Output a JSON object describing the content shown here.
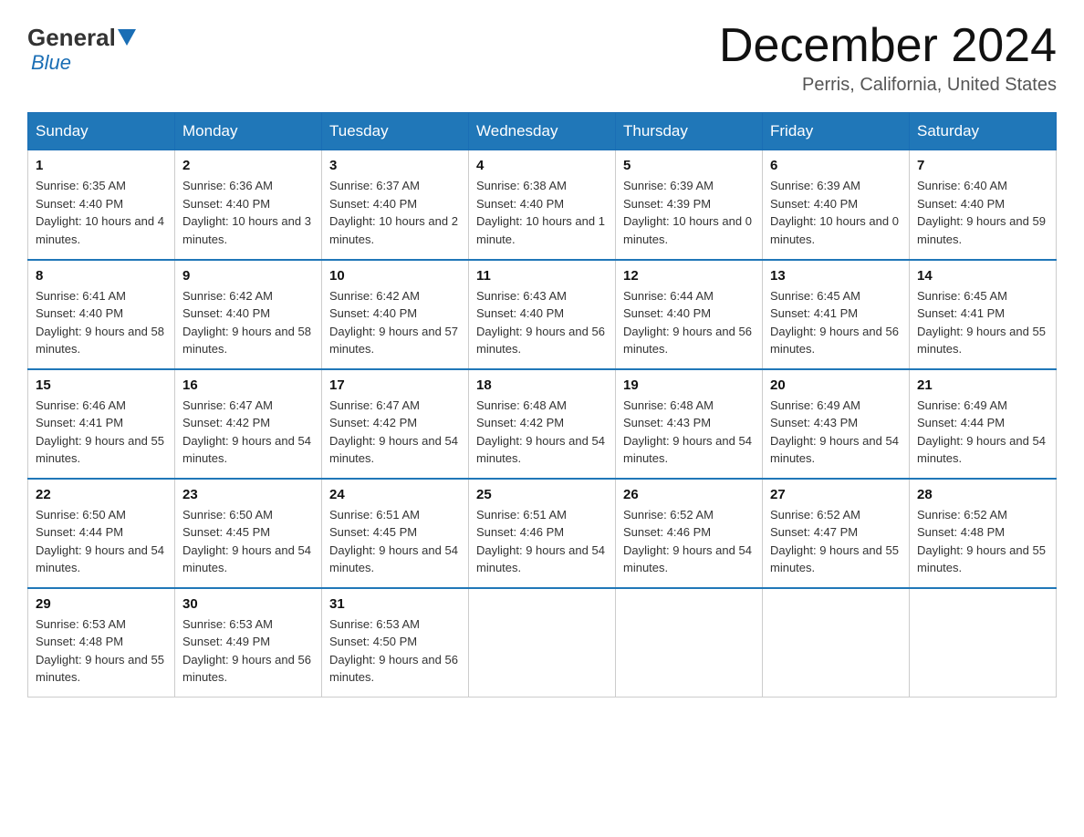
{
  "logo": {
    "general": "General",
    "blue": "Blue"
  },
  "title": "December 2024",
  "location": "Perris, California, United States",
  "weekdays": [
    "Sunday",
    "Monday",
    "Tuesday",
    "Wednesday",
    "Thursday",
    "Friday",
    "Saturday"
  ],
  "weeks": [
    [
      {
        "day": "1",
        "sunrise": "6:35 AM",
        "sunset": "4:40 PM",
        "daylight": "10 hours and 4 minutes."
      },
      {
        "day": "2",
        "sunrise": "6:36 AM",
        "sunset": "4:40 PM",
        "daylight": "10 hours and 3 minutes."
      },
      {
        "day": "3",
        "sunrise": "6:37 AM",
        "sunset": "4:40 PM",
        "daylight": "10 hours and 2 minutes."
      },
      {
        "day": "4",
        "sunrise": "6:38 AM",
        "sunset": "4:40 PM",
        "daylight": "10 hours and 1 minute."
      },
      {
        "day": "5",
        "sunrise": "6:39 AM",
        "sunset": "4:39 PM",
        "daylight": "10 hours and 0 minutes."
      },
      {
        "day": "6",
        "sunrise": "6:39 AM",
        "sunset": "4:40 PM",
        "daylight": "10 hours and 0 minutes."
      },
      {
        "day": "7",
        "sunrise": "6:40 AM",
        "sunset": "4:40 PM",
        "daylight": "9 hours and 59 minutes."
      }
    ],
    [
      {
        "day": "8",
        "sunrise": "6:41 AM",
        "sunset": "4:40 PM",
        "daylight": "9 hours and 58 minutes."
      },
      {
        "day": "9",
        "sunrise": "6:42 AM",
        "sunset": "4:40 PM",
        "daylight": "9 hours and 58 minutes."
      },
      {
        "day": "10",
        "sunrise": "6:42 AM",
        "sunset": "4:40 PM",
        "daylight": "9 hours and 57 minutes."
      },
      {
        "day": "11",
        "sunrise": "6:43 AM",
        "sunset": "4:40 PM",
        "daylight": "9 hours and 56 minutes."
      },
      {
        "day": "12",
        "sunrise": "6:44 AM",
        "sunset": "4:40 PM",
        "daylight": "9 hours and 56 minutes."
      },
      {
        "day": "13",
        "sunrise": "6:45 AM",
        "sunset": "4:41 PM",
        "daylight": "9 hours and 56 minutes."
      },
      {
        "day": "14",
        "sunrise": "6:45 AM",
        "sunset": "4:41 PM",
        "daylight": "9 hours and 55 minutes."
      }
    ],
    [
      {
        "day": "15",
        "sunrise": "6:46 AM",
        "sunset": "4:41 PM",
        "daylight": "9 hours and 55 minutes."
      },
      {
        "day": "16",
        "sunrise": "6:47 AM",
        "sunset": "4:42 PM",
        "daylight": "9 hours and 54 minutes."
      },
      {
        "day": "17",
        "sunrise": "6:47 AM",
        "sunset": "4:42 PM",
        "daylight": "9 hours and 54 minutes."
      },
      {
        "day": "18",
        "sunrise": "6:48 AM",
        "sunset": "4:42 PM",
        "daylight": "9 hours and 54 minutes."
      },
      {
        "day": "19",
        "sunrise": "6:48 AM",
        "sunset": "4:43 PM",
        "daylight": "9 hours and 54 minutes."
      },
      {
        "day": "20",
        "sunrise": "6:49 AM",
        "sunset": "4:43 PM",
        "daylight": "9 hours and 54 minutes."
      },
      {
        "day": "21",
        "sunrise": "6:49 AM",
        "sunset": "4:44 PM",
        "daylight": "9 hours and 54 minutes."
      }
    ],
    [
      {
        "day": "22",
        "sunrise": "6:50 AM",
        "sunset": "4:44 PM",
        "daylight": "9 hours and 54 minutes."
      },
      {
        "day": "23",
        "sunrise": "6:50 AM",
        "sunset": "4:45 PM",
        "daylight": "9 hours and 54 minutes."
      },
      {
        "day": "24",
        "sunrise": "6:51 AM",
        "sunset": "4:45 PM",
        "daylight": "9 hours and 54 minutes."
      },
      {
        "day": "25",
        "sunrise": "6:51 AM",
        "sunset": "4:46 PM",
        "daylight": "9 hours and 54 minutes."
      },
      {
        "day": "26",
        "sunrise": "6:52 AM",
        "sunset": "4:46 PM",
        "daylight": "9 hours and 54 minutes."
      },
      {
        "day": "27",
        "sunrise": "6:52 AM",
        "sunset": "4:47 PM",
        "daylight": "9 hours and 55 minutes."
      },
      {
        "day": "28",
        "sunrise": "6:52 AM",
        "sunset": "4:48 PM",
        "daylight": "9 hours and 55 minutes."
      }
    ],
    [
      {
        "day": "29",
        "sunrise": "6:53 AM",
        "sunset": "4:48 PM",
        "daylight": "9 hours and 55 minutes."
      },
      {
        "day": "30",
        "sunrise": "6:53 AM",
        "sunset": "4:49 PM",
        "daylight": "9 hours and 56 minutes."
      },
      {
        "day": "31",
        "sunrise": "6:53 AM",
        "sunset": "4:50 PM",
        "daylight": "9 hours and 56 minutes."
      },
      null,
      null,
      null,
      null
    ]
  ]
}
